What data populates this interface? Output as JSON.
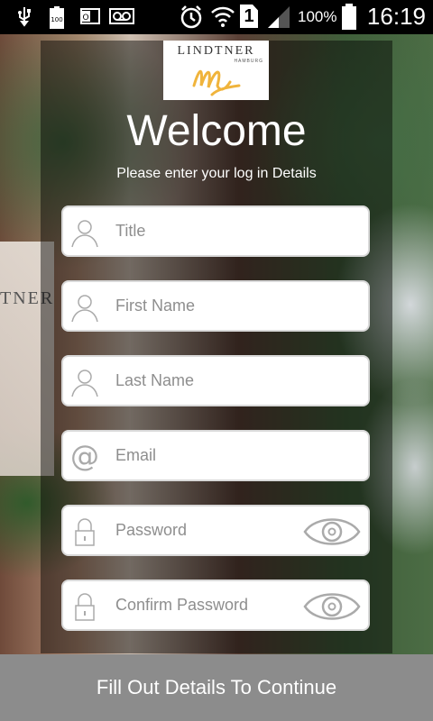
{
  "status_bar": {
    "battery_percent": "100%",
    "time": "16:19",
    "sim_badge": "1",
    "left_icons": [
      "usb-icon",
      "battery-100-icon",
      "outlook-icon",
      "voicemail-icon"
    ],
    "right_icons": [
      "alarm-icon",
      "wifi-icon",
      "sim-icon",
      "signal-icon",
      "battery-icon"
    ]
  },
  "logo": {
    "name": "LINDTNER",
    "subname": "HAMBURG"
  },
  "background": {
    "wall_text": "TNER"
  },
  "header": {
    "title": "Welcome",
    "subtitle": "Please enter your log in Details"
  },
  "form": {
    "title_placeholder": "Title",
    "first_name_placeholder": "First Name",
    "last_name_placeholder": "Last Name",
    "email_placeholder": "Email",
    "password_placeholder": "Password",
    "confirm_password_placeholder": "Confirm Password"
  },
  "footer": {
    "button_label": "Fill Out Details To Continue"
  },
  "colors": {
    "panel": "#000000",
    "field_border": "#d9d9d9",
    "icon": "#aaaaaa",
    "button": "#8c8c8c"
  }
}
